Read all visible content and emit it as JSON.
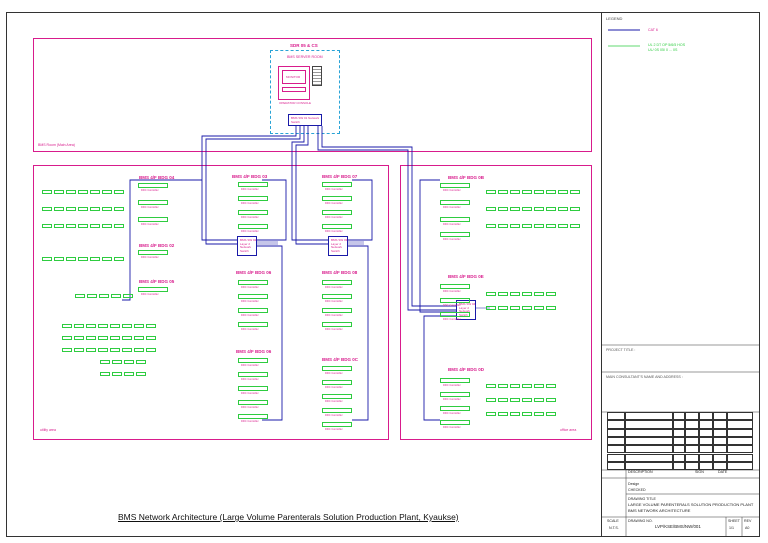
{
  "main_caption": "BMS Network Architecture  (Large Volume Parenterals Solution Production Plant, Kyaukse)",
  "legend": {
    "title": "LEGEND",
    "items": [
      {
        "label": "CAT 6",
        "color": "#1a1aa8"
      },
      {
        "label": "UL 2 DT OP 5/6/5 HOS\nUL/ 0S 05/ 0 ... 0S",
        "color": "#2ecc40"
      }
    ]
  },
  "top": {
    "title": "SDR 05 & CS",
    "server_label": "BMS SERVER ROOM",
    "workstation": "OPERATOR CONSOLE",
    "monitor": "MONITOR",
    "switch_label": "BMS SW 01 Network Switch",
    "area_label": "BMS Room (Main Area)"
  },
  "left_zone": {
    "groups": [
      {
        "title": "BMS 4/F BDG 04"
      },
      {
        "title": "BMS 4/F BDG 02"
      },
      {
        "title": "BMS 4/F BDG 05"
      },
      {
        "title": "BMS 4/F BDG 03"
      },
      {
        "title": "BMS 4/F BDG 06"
      },
      {
        "title": "BMS 4/F BDG 07"
      },
      {
        "title": "BMS 4/F BDG 08"
      },
      {
        "title": "BMS 4/F BDG 0C"
      }
    ],
    "switches": [
      "BMS SW 02\nLayer 2\nNetwork\nSwitch",
      "BMS SW 03\nLayer 2\nNetwork\nSwitch"
    ],
    "controller_label": "DDC Controller",
    "corner_label": "utility area"
  },
  "right_zone": {
    "groups": [
      {
        "title": "BMS 4/F BDG 0B"
      },
      {
        "title": "BMS 4/F BDG 0E"
      },
      {
        "title": "BMS 4/F BDG 0D"
      }
    ],
    "switch": "BMS SW 04\nLayer 2\nNetwork\nSwitch",
    "controller_label": "DDC Controller",
    "corner_label": "office area"
  },
  "panel": {
    "project_title": "PROJECT TITLE :",
    "consultant": "MAIN CONSULTANT'S NAME AND ADDRESS :",
    "drawing_title_label": "DRAWING TITLE",
    "drawing_title": "LARGE VOLUME PARENTERALS SOLUTION PRODUCTION PLANT",
    "drawing_subtitle": "BMS NETWORK ARCHITECTURE",
    "scale_label": "SCALE",
    "scale_value": "N.T.S.",
    "drawing_no_label": "DRAWING NO.",
    "drawing_no": "LVP/KSE/BMS/NW/001",
    "sheet_label": "SHEET",
    "sheet_value": "1/1",
    "rev_label": "REV",
    "rev_value": "A0",
    "description_label": "DESCRIPTION",
    "rev_col": "REV",
    "sign_label": "SIGN",
    "date_label": "DATE",
    "design_label": "Design",
    "checked_label": "CHECKED"
  }
}
